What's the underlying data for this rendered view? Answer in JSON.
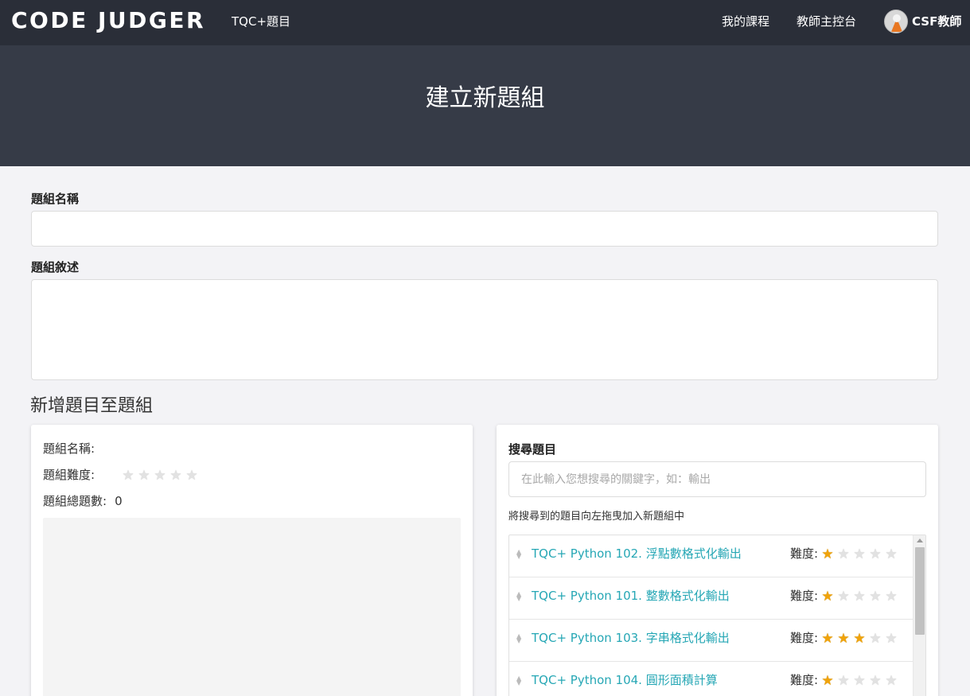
{
  "nav": {
    "brand": "CODE JUDGER",
    "tqc_link": "TQC+題目",
    "my_courses": "我的課程",
    "teacher_console": "教師主控台",
    "user_name": "CSF教師"
  },
  "hero": {
    "title": "建立新題組"
  },
  "form": {
    "name_label": "題組名稱",
    "name_value": "",
    "description_label": "題組敘述",
    "description_value": "",
    "section_title": "新增題目至題組"
  },
  "group_info": {
    "name_label": "題組名稱:",
    "name_value": "",
    "difficulty_label": "題組難度:",
    "difficulty_stars": 0,
    "total_label": "題組總題數:",
    "total_value": "0"
  },
  "search": {
    "label": "搜尋題目",
    "placeholder": "在此輸入您想搜尋的關鍵字，如：輸出",
    "value": "",
    "hint": "將搜尋到的題目向左拖曳加入新題組中"
  },
  "questions": [
    {
      "title": "TQC+ Python 102. 浮點數格式化輸出",
      "difficulty_label": "難度:",
      "stars": 1
    },
    {
      "title": "TQC+ Python 101. 整數格式化輸出",
      "difficulty_label": "難度:",
      "stars": 1
    },
    {
      "title": "TQC+ Python 103. 字串格式化輸出",
      "difficulty_label": "難度:",
      "stars": 3
    },
    {
      "title": "TQC+ Python 104. 圓形面積計算",
      "difficulty_label": "難度:",
      "stars": 1
    }
  ],
  "colors": {
    "navbar": "#2a2e38",
    "hero": "#363b47",
    "link": "#26a7b5",
    "star_on": "#f0a30a",
    "star_off": "#e2e2e2"
  },
  "icons": {
    "star": "star-icon",
    "drag_handle": "drag-handle-icon",
    "avatar": "user-avatar-icon"
  }
}
